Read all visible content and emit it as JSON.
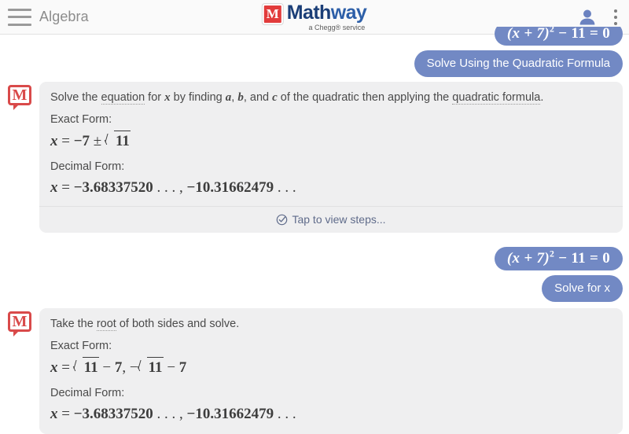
{
  "header": {
    "menu_icon": "hamburger-icon",
    "subject": "Algebra",
    "brand": {
      "mark": "mathway-logo-icon",
      "name_main": "Math",
      "name_accent": "way",
      "tagline": "a Chegg® service"
    },
    "account_icon": "person-icon",
    "overflow_icon": "kebab-menu-icon"
  },
  "conversation": [
    {
      "kind": "question",
      "expr_base": "(x + 7)",
      "expr_sup": "2",
      "expr_tail": " − 11 = 0"
    },
    {
      "kind": "action",
      "label": "Solve Using the Quadratic Formula"
    },
    {
      "kind": "answer",
      "avatar": "mathway-avatar-icon",
      "intro": {
        "parts": [
          {
            "t": "text",
            "v": "Solve the "
          },
          {
            "t": "gloss",
            "v": "equation"
          },
          {
            "t": "text",
            "v": " for "
          },
          {
            "t": "math",
            "v": "x"
          },
          {
            "t": "text",
            "v": " by finding "
          },
          {
            "t": "math",
            "v": "a"
          },
          {
            "t": "text",
            "v": ", "
          },
          {
            "t": "math",
            "v": "b"
          },
          {
            "t": "text",
            "v": ", and "
          },
          {
            "t": "math",
            "v": "c"
          },
          {
            "t": "text",
            "v": " of the quadratic then applying the "
          },
          {
            "t": "gloss",
            "v": "quadratic formula"
          },
          {
            "t": "text",
            "v": "."
          }
        ]
      },
      "exact_label": "Exact Form:",
      "exact_value": "x = −7 ± √11",
      "decimal_label": "Decimal Form:",
      "decimal_value": "x = −3.68337520 . . . , −10.31662479 . . .",
      "steps_icon": "check-circle-icon",
      "steps_label": "Tap to view steps..."
    },
    {
      "kind": "question",
      "expr_base": "(x + 7)",
      "expr_sup": "2",
      "expr_tail": " − 11 = 0"
    },
    {
      "kind": "action",
      "label": "Solve for x"
    },
    {
      "kind": "answer",
      "avatar": "mathway-avatar-icon",
      "intro": {
        "parts": [
          {
            "t": "text",
            "v": "Take the "
          },
          {
            "t": "gloss",
            "v": "root"
          },
          {
            "t": "text",
            "v": " of both sides and solve."
          }
        ]
      },
      "exact_label": "Exact Form:",
      "exact_value": "x = √11 − 7, −√11 − 7",
      "decimal_label": "Decimal Form:",
      "decimal_value": "x = −3.68337520 . . . , −10.31662479 . . ."
    }
  ],
  "colors": {
    "bubble_blue": "#7289c4",
    "card_gray": "#efeff0",
    "brand_red": "#e23b3b",
    "brand_navy": "#1b3e77",
    "header_bg": "#fafafa",
    "steps_text": "#5f6b8a"
  }
}
